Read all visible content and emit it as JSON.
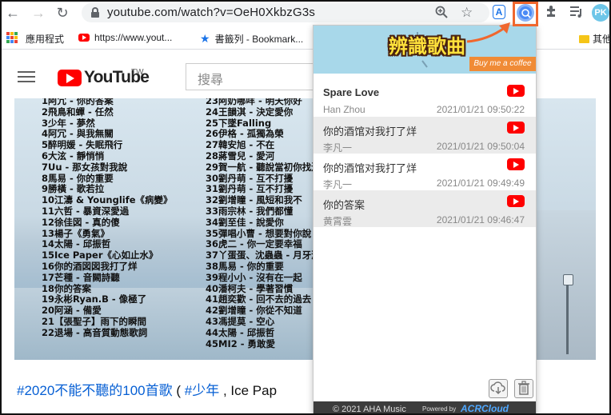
{
  "browser": {
    "url": "youtube.com/watch?v=OeH0XkbzG3s",
    "extensions": {
      "extension_one_label": "A",
      "profile_label": "PK"
    }
  },
  "bookmarks": [
    {
      "label": "應用程式",
      "icon": "apps-grid-icon"
    },
    {
      "label": "https://www.yout...",
      "icon": "youtube-icon"
    },
    {
      "label": "書籤列 - Bookmark...",
      "icon": "star-icon"
    },
    {
      "label": "其他",
      "icon": "folder-icon"
    }
  ],
  "youtube": {
    "wordmark": "YouTube",
    "region": "TW",
    "search_placeholder": "搜尋",
    "avatar_label": "PK"
  },
  "video": {
    "songs_left": [
      "1阿冗 - 你的答案",
      "2飛鳥和蟬 - 任然",
      "3少年 - 夢然",
      "4阿冗 - 與我無關",
      "5醉明媛 - 失眠飛行",
      "6大泫 - 靜悄悄",
      "7Uu - 那女孩對我說",
      "8馬易 - 你的重要",
      "9勝橫 - 歌若拉",
      "10江濤 & Younglife《病變》",
      "11六哲 - 暴資深愛過",
      "12徐佳図 - 真的傻",
      "13楊子《勇氣》",
      "14太陽 - 邱振哲",
      "15Ice Paper《心如止水》",
      "16你的酒図図我打了烊",
      "17芒種 - 音闕詩聽",
      "18你的答案",
      "19永彬Ryan.B - 像極了",
      "20阿涵 - 備愛",
      "21【張聖子】雨下的瞬間",
      "22退場 - 高音質動態歌詞"
    ],
    "songs_right": [
      "23阿奶哪咩 - 明天你好",
      "24王韻淇 - 決定愛你",
      "25下墜Falling",
      "26伊格 - 孤獨為榮",
      "27韓安旭 - 不在",
      "28蔣雪兒 - 愛河",
      "29賀一航 - 聽說當初你找過我",
      "30劉丹萌 - 互不打擾",
      "31劉丹萌 - 互不打擾",
      "32劉增瞳 - 風短和我不",
      "33雨宗林 - 我們都懂",
      "34劉至佳 - 說愛你",
      "35彈唱小曹 - 想要對你說",
      "36虎二 - 你一定要幸福",
      "37丫蛋蛋、沈蟲蟲 - 月牙灣",
      "38馬易 - 你的重要",
      "39程小小 - 沒有在一起",
      "40潘柯夫 - 學著習慣",
      "41趙奕歡 - 回不去的過去",
      "42劉增瞳 - 你從不知道",
      "43馮提莫 - 空心",
      "44太陽 - 邱振哲",
      "45MI2 - 勇敢愛"
    ]
  },
  "description": {
    "tag1": "#2020不能不聽的100首歌",
    "middle": " ( ",
    "tag2": "#少年",
    "rest": " , Ice Pap"
  },
  "popup": {
    "banner_button": "Buy me a coffee",
    "songs": [
      {
        "title": "Spare Love",
        "artist": "Han Zhou",
        "time": "2021/01/21 09:50:22"
      },
      {
        "title": "你的酒馆对我打了烊",
        "artist": "李凡一",
        "time": "2021/01/21 09:50:04"
      },
      {
        "title": "你的酒馆对我打了烊",
        "artist": "李凡一",
        "time": "2021/01/21 09:49:49"
      },
      {
        "title": "你的答案",
        "artist": "黄霄雲",
        "time": "2021/01/21 09:46:47"
      }
    ],
    "footer_copyright": "© 2021 AHA Music",
    "footer_powered": "Powered by",
    "footer_acr": "ACRCloud"
  },
  "annotation": {
    "callout": "辨識歌曲",
    "color": "#f0672e"
  }
}
